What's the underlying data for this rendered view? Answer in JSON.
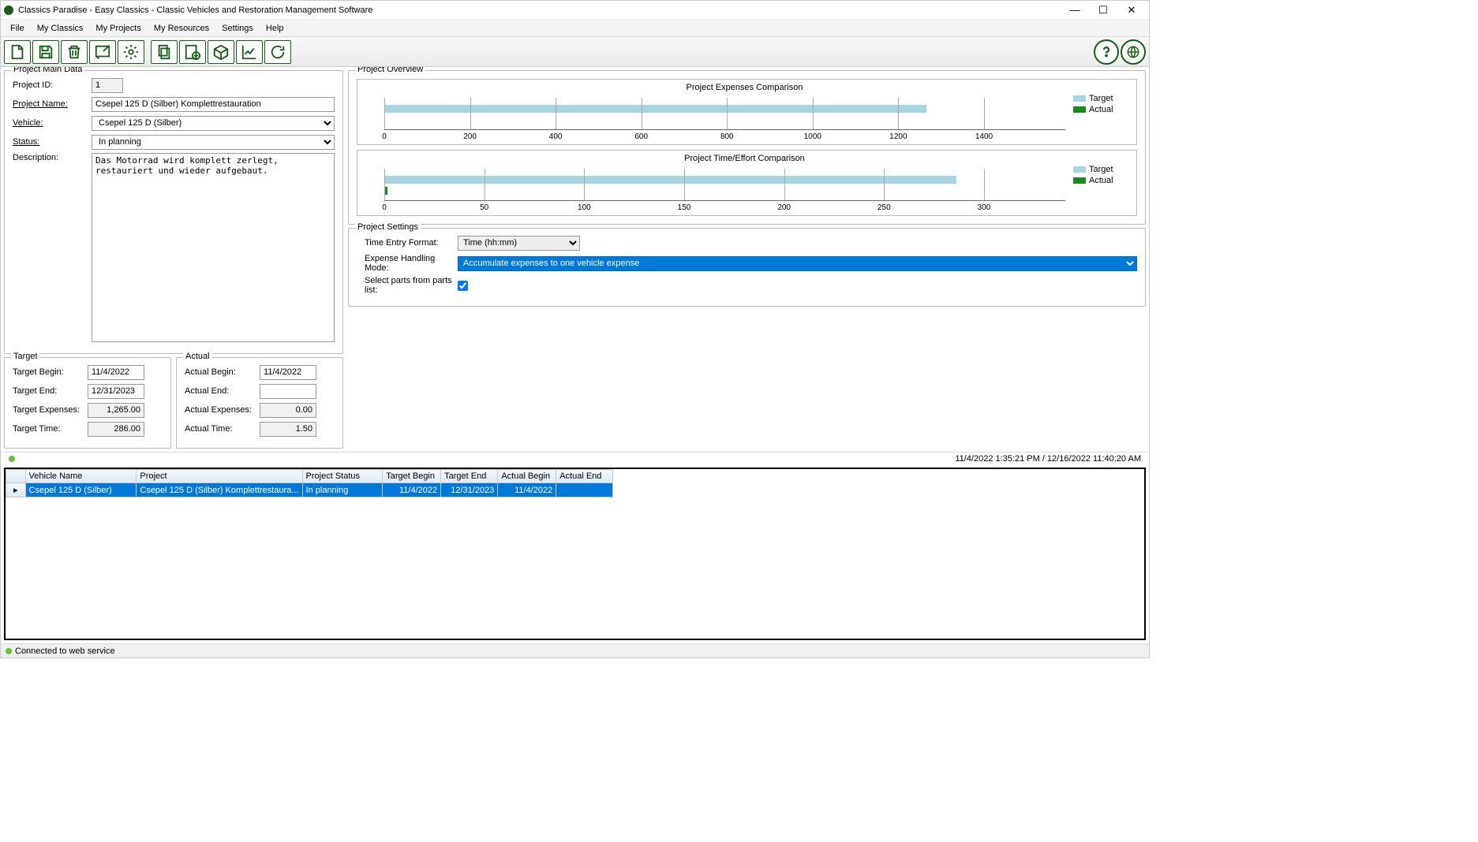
{
  "window": {
    "title": "Classics Paradise - Easy Classics - Classic Vehicles and Restoration Management Software"
  },
  "menu": {
    "file": "File",
    "classics": "My Classics",
    "projects": "My Projects",
    "resources": "My Resources",
    "settings": "Settings",
    "help": "Help"
  },
  "main_data": {
    "legend": "Project Main Data",
    "id_label": "Project ID:",
    "id": "1",
    "name_label": "Project Name:",
    "name": "Csepel 125 D (Silber) Komplettrestauration",
    "vehicle_label": "Vehicle:",
    "vehicle": "Csepel 125 D (Silber)",
    "status_label": "Status:",
    "status": "In planning",
    "desc_label": "Description:",
    "desc": "Das Motorrad wird komplett zerlegt, restauriert und wieder aufgebaut."
  },
  "target": {
    "legend": "Target",
    "begin_label": "Target Begin:",
    "begin": "11/4/2022",
    "end_label": "Target End:",
    "end": "12/31/2023",
    "exp_label": "Target Expenses:",
    "exp": "1,265.00",
    "time_label": "Target Time:",
    "time": "286.00"
  },
  "actual": {
    "legend": "Actual",
    "begin_label": "Actual Begin:",
    "begin": "11/4/2022",
    "end_label": "Actual End:",
    "end": "",
    "exp_label": "Actual Expenses:",
    "exp": "0.00",
    "time_label": "Actual Time:",
    "time": "1.50"
  },
  "overview": {
    "legend": "Project Overview",
    "legend_target": "Target",
    "legend_actual": "Actual",
    "color_target": "#aad4df",
    "color_actual": "#1a8a1a"
  },
  "settings": {
    "legend": "Project Settings",
    "time_format_label": "Time Entry Format:",
    "time_format": "Time (hh:mm)",
    "expense_mode_label": "Expense Handling Mode:",
    "expense_mode": "Accumulate expenses to one vehicle expense",
    "parts_label": "Select parts from parts list:",
    "parts_checked": true
  },
  "status": {
    "timestamp": "11/4/2022 1:35:21 PM / 12/16/2022 11:40:20 AM"
  },
  "grid": {
    "headers": {
      "vehicle": "Vehicle Name",
      "project": "Project",
      "status": "Project Status",
      "tbegin": "Target Begin",
      "tend": "Target End",
      "abegin": "Actual Begin",
      "aend": "Actual End"
    },
    "row": {
      "vehicle": "Csepel 125 D (Silber)",
      "project": "Csepel 125 D (Silber) Komplettrestaura...",
      "status": "In planning",
      "tbegin": "11/4/2022",
      "tend": "12/31/2023",
      "abegin": "11/4/2022",
      "aend": ""
    },
    "row_indicator": "▸"
  },
  "footer": {
    "text": "Connected to web service"
  },
  "chart_data": [
    {
      "type": "bar",
      "title": "Project Expenses Comparison",
      "orientation": "horizontal",
      "xlim": [
        0,
        1400
      ],
      "ticks": [
        0,
        200,
        400,
        600,
        800,
        1000,
        1200,
        1400
      ],
      "series": [
        {
          "name": "Target",
          "color": "#aad4df",
          "values": [
            1265
          ]
        },
        {
          "name": "Actual",
          "color": "#1a8a1a",
          "values": [
            0
          ]
        }
      ]
    },
    {
      "type": "bar",
      "title": "Project Time/Effort Comparison",
      "orientation": "horizontal",
      "xlim": [
        0,
        300
      ],
      "ticks": [
        0,
        50,
        100,
        150,
        200,
        250,
        300
      ],
      "series": [
        {
          "name": "Target",
          "color": "#aad4df",
          "values": [
            286
          ]
        },
        {
          "name": "Actual",
          "color": "#1a8a1a",
          "values": [
            1.5
          ]
        }
      ]
    }
  ]
}
